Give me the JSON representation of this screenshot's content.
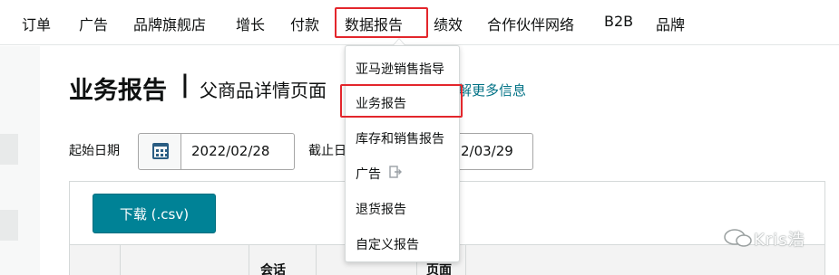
{
  "nav": {
    "items": [
      "订单",
      "广告",
      "品牌旗舰店",
      "增长",
      "付款",
      "数据报告",
      "绩效",
      "合作伙伴网络",
      "B2B",
      "品牌"
    ]
  },
  "heading": {
    "title": "业务报告",
    "separator": "|",
    "subtitle": "父商品详情页面",
    "learn_more": "解更多信息"
  },
  "filters": {
    "start_label": "起始日期",
    "start_date": "2022/02/28",
    "end_label": "截止日",
    "end_date": "2/03/29"
  },
  "report": {
    "download_label": "下载 (.csv)",
    "col_session": "会话",
    "col_page": "页面"
  },
  "dropdown": {
    "items": [
      "亚马逊销售指导",
      "业务报告",
      "库存和销售报告",
      "广告",
      "退货报告",
      "自定义报告"
    ],
    "highlighted": "业务报告"
  },
  "watermark": {
    "text": "Kris浩"
  },
  "colors": {
    "highlight_border": "#e3262c",
    "primary_button": "#008296",
    "link": "#007185",
    "calendar_icon": "#2a5d83"
  }
}
